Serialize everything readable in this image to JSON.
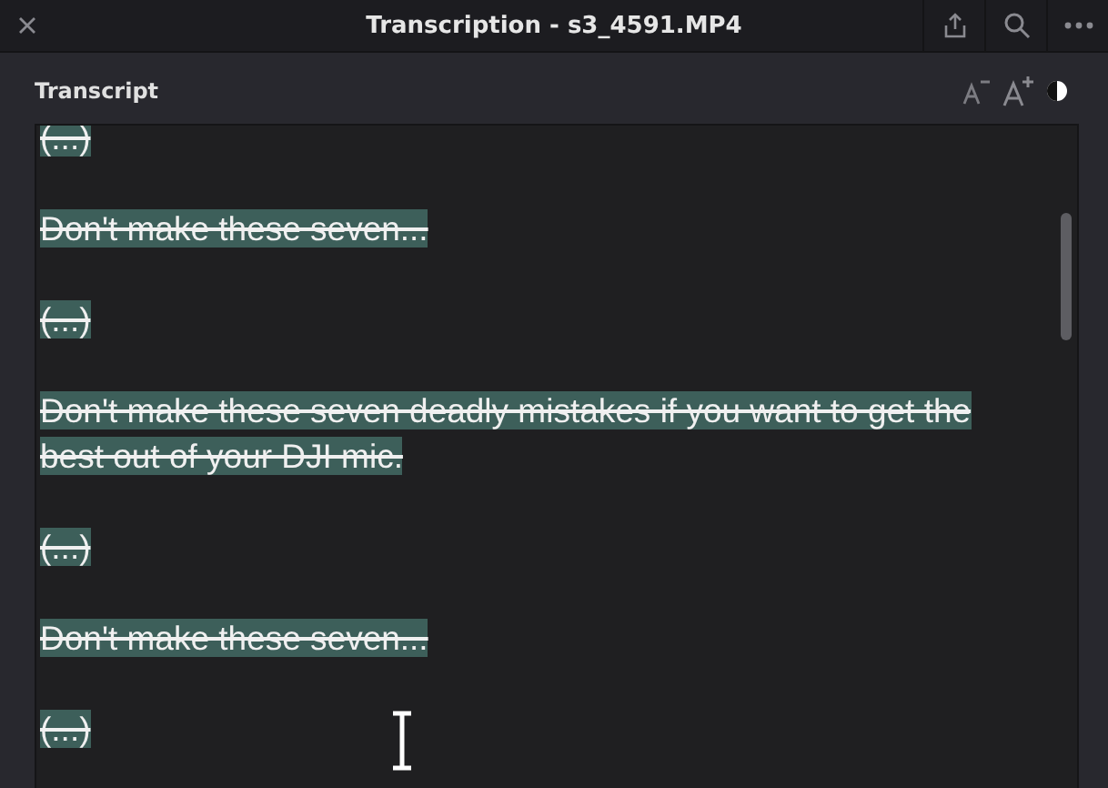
{
  "window": {
    "title": "Transcription - s3_4591.MP4"
  },
  "panel": {
    "title": "Transcript"
  },
  "segments": [
    {
      "text": "(...)",
      "struck": true,
      "highlighted": true
    },
    {
      "text": "Don't make these seven...",
      "struck": true,
      "highlighted": true
    },
    {
      "text": "(...)",
      "struck": true,
      "highlighted": true
    },
    {
      "text": "Don't make these seven deadly mistakes if you want to get the best out of your DJI mic.",
      "struck": true,
      "highlighted": true
    },
    {
      "text": "(...)",
      "struck": true,
      "highlighted": true
    },
    {
      "text": "Don't make these seven...",
      "struck": true,
      "highlighted": true
    },
    {
      "text": "(...)",
      "struck": true,
      "highlighted": true
    }
  ]
}
